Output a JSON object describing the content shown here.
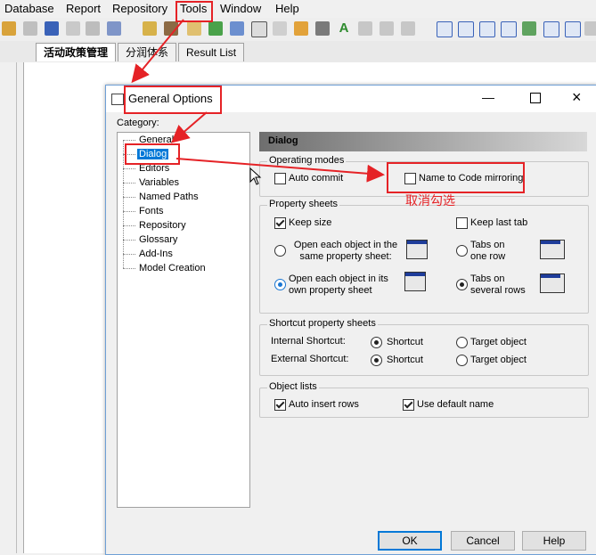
{
  "menu": {
    "items": [
      "Database",
      "Report",
      "Repository",
      "Tools",
      "Window",
      "Help"
    ]
  },
  "tabs": [
    "活动政策管理",
    "分润体系",
    "Result List"
  ],
  "dialog": {
    "title": "General Options",
    "category_label": "Category:",
    "categories": [
      "General",
      "Dialog",
      "Editors",
      "Variables",
      "Named Paths",
      "Fonts",
      "Repository",
      "Glossary",
      "Add-Ins",
      "Model Creation"
    ],
    "pane_title": "Dialog",
    "operating_modes": {
      "title": "Operating modes",
      "auto_commit": "Auto commit",
      "name_to_code": "Name to Code mirroring"
    },
    "property_sheets": {
      "title": "Property sheets",
      "keep_size": "Keep size",
      "keep_last_tab": "Keep last tab",
      "open_same": "Open each object in the same property sheet:",
      "open_own": "Open each object in its own property sheet",
      "tabs_one": "Tabs on one row",
      "tabs_several": "Tabs on several rows"
    },
    "shortcut_sheets": {
      "title": "Shortcut property sheets",
      "internal": "Internal Shortcut:",
      "external": "External Shortcut:",
      "shortcut": "Shortcut",
      "target": "Target object"
    },
    "object_lists": {
      "title": "Object lists",
      "auto_insert": "Auto insert rows",
      "use_default": "Use default name"
    },
    "buttons": {
      "ok": "OK",
      "cancel": "Cancel",
      "help": "Help"
    }
  },
  "annotation": {
    "text": "取消勾选",
    "color": "#e52226"
  }
}
